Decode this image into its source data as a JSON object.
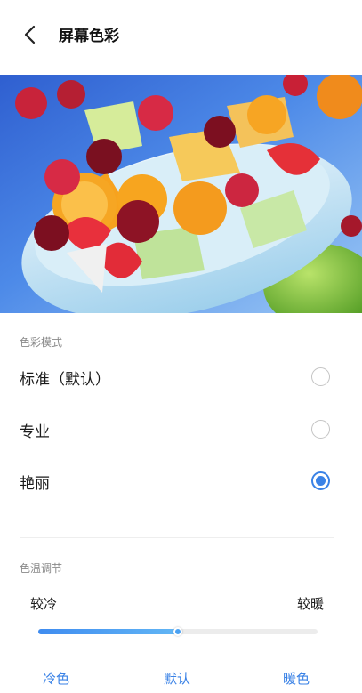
{
  "header": {
    "title": "屏幕色彩"
  },
  "color_mode": {
    "section_label": "色彩模式",
    "options": [
      {
        "label": "标准（默认）",
        "selected": false
      },
      {
        "label": "专业",
        "selected": false
      },
      {
        "label": "艳丽",
        "selected": true
      }
    ]
  },
  "color_temperature": {
    "section_label": "色温调节",
    "cold_label": "较冷",
    "warm_label": "较暖",
    "slider_value": 0.5,
    "presets": [
      "冷色",
      "默认",
      "暖色"
    ]
  },
  "colors": {
    "accent": "#3a82e6"
  }
}
